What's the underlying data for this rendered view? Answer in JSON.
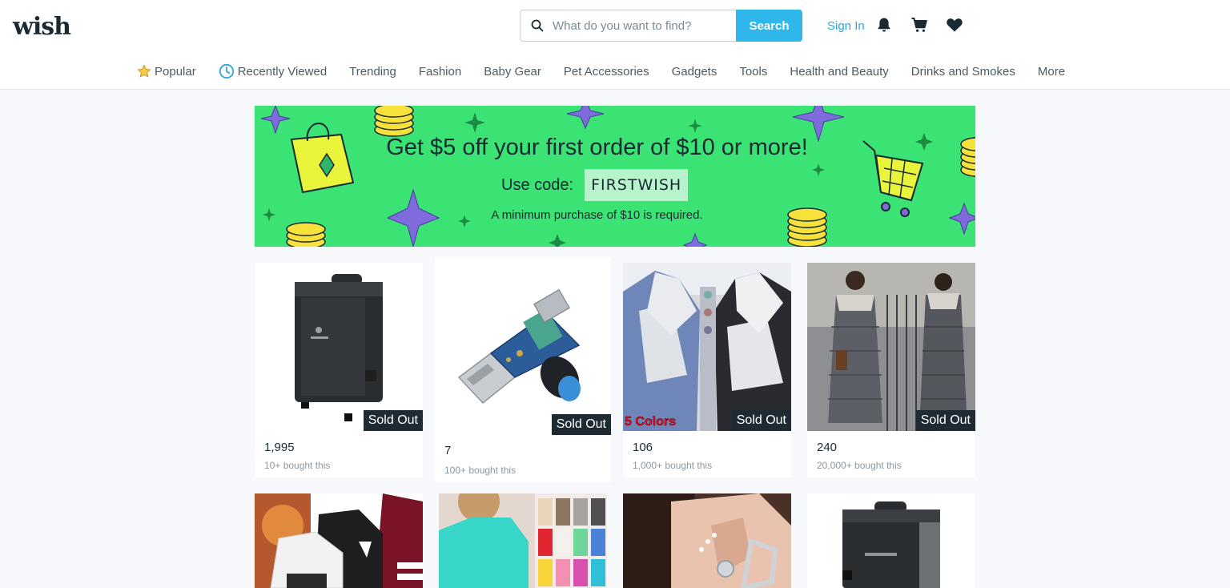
{
  "header": {
    "logo": "wish",
    "search": {
      "placeholder": "What do you want to find?",
      "button_label": "Search"
    },
    "signin_label": "Sign In",
    "icons": [
      "bell-icon",
      "cart-icon",
      "heart-icon"
    ]
  },
  "nav": {
    "items": [
      {
        "label": "Popular",
        "icon": "star-icon"
      },
      {
        "label": "Recently Viewed",
        "icon": "clock-icon"
      },
      {
        "label": "Trending"
      },
      {
        "label": "Fashion"
      },
      {
        "label": "Baby Gear"
      },
      {
        "label": "Pet Accessories"
      },
      {
        "label": "Gadgets"
      },
      {
        "label": "Tools"
      },
      {
        "label": "Health and Beauty"
      },
      {
        "label": "Drinks and Smokes"
      },
      {
        "label": "More"
      }
    ]
  },
  "banner": {
    "title": "Get $5 off your first order of $10 or more!",
    "code_label": "Use code:",
    "code": "FIRSTWISH",
    "note": "A minimum purchase of $10 is required."
  },
  "products": [
    {
      "price": "1,995",
      "bought": "10+ bought this",
      "badge": "Sold Out",
      "image": "electric-smoker"
    },
    {
      "price": "7",
      "bought": "100+ bought this",
      "badge": "Sold Out",
      "image": "usb-speed-controller"
    },
    {
      "price": "106",
      "bought": "1,000+ bought this",
      "badge": "Sold Out",
      "tag": "5 Colors",
      "image": "fleece-hoodie-jackets"
    },
    {
      "price": "240",
      "bought": "20,000+ bought this",
      "badge": "Sold Out",
      "image": "long-puffer-coat"
    },
    {
      "image": "printed-hoodies"
    },
    {
      "image": "fluffy-sweaters"
    },
    {
      "image": "ear-cuff-earrings"
    },
    {
      "image": "electric-smoker-2"
    }
  ],
  "colors": {
    "search_button": "#2fb7ec",
    "signin": "#2fa5d8",
    "banner_bg": "#3ae374",
    "code_bg": "#b7f4cb",
    "sold_out_bg": "#1f2b33"
  }
}
